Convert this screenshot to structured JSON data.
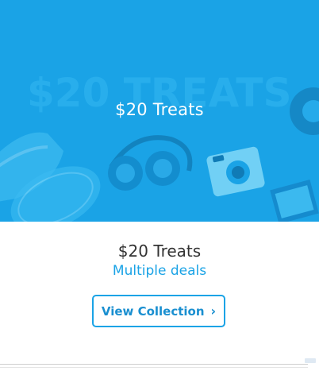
{
  "hero": {
    "title": "$20 Treats",
    "background_text": "$20 TREATS",
    "background_color": "#1aa3e6"
  },
  "card": {
    "title": "$20 Treats",
    "subtitle": "Multiple deals",
    "button_label": "View Collection",
    "accent_color": "#1aa3e6"
  },
  "icons": {
    "button_chevron": "chevron-right-icon"
  }
}
